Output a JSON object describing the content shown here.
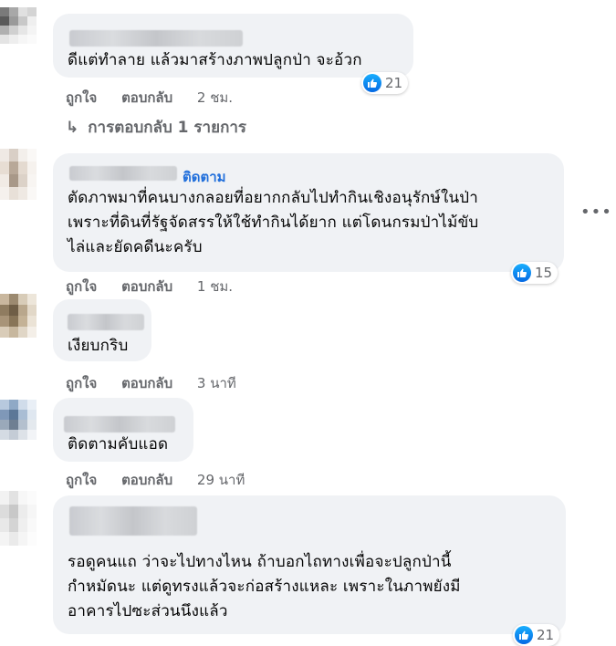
{
  "comments": [
    {
      "text": "ดีแต่ทำลาย แล้วมาสร้างภาพปลูกป่า จะอ้วก",
      "actions": {
        "like": "ถูกใจ",
        "reply": "ตอบกลับ",
        "time": "2 ชม."
      },
      "reactions": {
        "icon": "like-icon",
        "count": "21"
      },
      "replies_link": "การตอบกลับ 1 รายการ"
    },
    {
      "follow_label": "ติดตาม",
      "text": "ตัดภาพมาที่คนบางกลอยที่อยากกลับไปทำกินเชิงอนุรักษ์ในป่า\nเพราะที่ดินที่รัฐจัดสรรให้ใช้ทำกินได้ยาก แต่โดนกรมป่าไม้ขับ\nไล่และยัดคดีนะครับ",
      "actions": {
        "like": "ถูกใจ",
        "reply": "ตอบกลับ",
        "time": "1 ชม."
      },
      "reactions": {
        "icon": "like-icon",
        "count": "15"
      },
      "more_icon": "more-options-icon"
    },
    {
      "text": "เงียบกริบ",
      "actions": {
        "like": "ถูกใจ",
        "reply": "ตอบกลับ",
        "time": "3 นาที"
      }
    },
    {
      "text": "ติดตามคับแอด",
      "actions": {
        "like": "ถูกใจ",
        "reply": "ตอบกลับ",
        "time": "29 นาที"
      }
    },
    {
      "text": "รอดูคนแถ ว่าจะไปทางไหน ถ้าบอกไถทางเพื่อจะปลูกป่านี้\nกำหมัดนะ แต่ดูทรงแล้วจะก่อสร้างแหละ เพราะในภาพยังมี\nอาคารไปซะส่วนนึงแล้ว",
      "reactions": {
        "icon": "like-icon",
        "count": "21"
      }
    }
  ],
  "colors": {
    "bubble": "#f0f2f5",
    "link_blue": "#216fdb",
    "secondary_text": "#65676b",
    "like_blue": "#0a7cff"
  }
}
